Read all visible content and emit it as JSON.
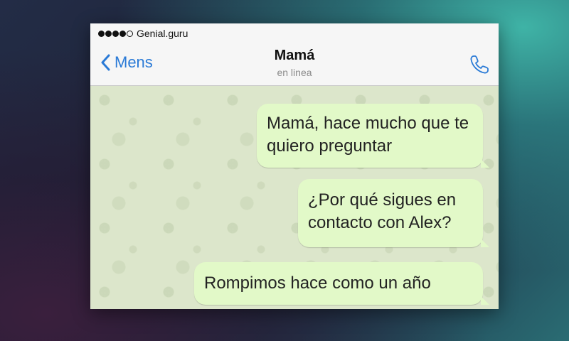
{
  "status_bar": {
    "carrier": "Genial.guru",
    "signal_bars_filled": 4,
    "signal_bars_total": 5
  },
  "nav": {
    "back_label": "Mens",
    "contact_name": "Mamá",
    "contact_status": "en linea",
    "call_icon": "phone-icon"
  },
  "messages": [
    {
      "text": "Mamá, hace mucho que te quiero preguntar"
    },
    {
      "text": "¿Por qué sigues en contacto con Alex?"
    },
    {
      "text": "Rompimos hace como un año"
    }
  ],
  "colors": {
    "accent": "#2a7ad6",
    "bubble_outgoing": "#e2f9c8",
    "chat_background": "#dce6cb"
  }
}
